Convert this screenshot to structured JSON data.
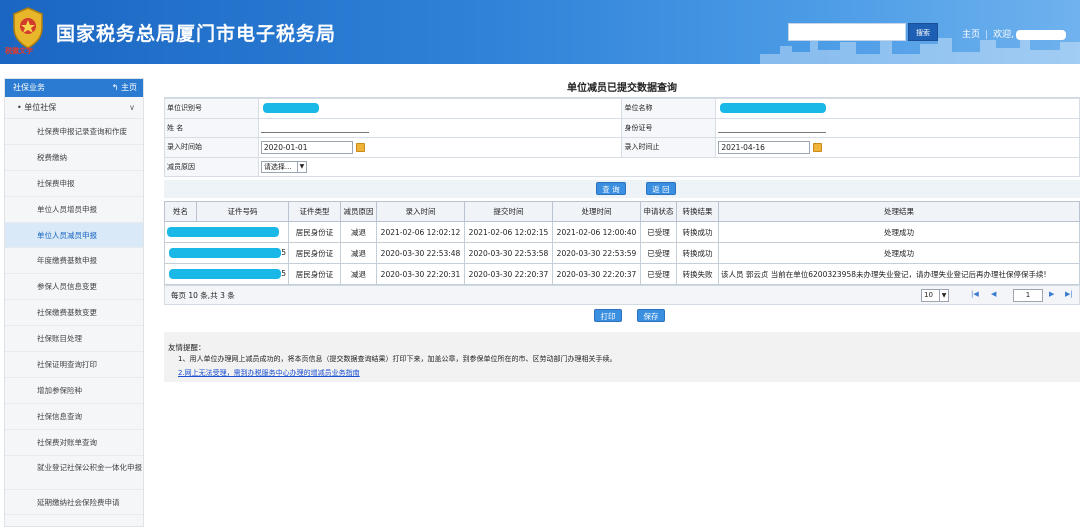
{
  "header": {
    "site_title": "国家税务总局厦门市电子税务局",
    "emblem_caption": "税徽文字",
    "search_button": "搜索",
    "home_link": "主页",
    "welcome": "欢迎,"
  },
  "sidebar": {
    "section": "社保业务",
    "home": "主页",
    "group": "单位社保",
    "items": [
      "社保费申报记录查询和作废",
      "税费缴纳",
      "社保费申报",
      "单位人员增员申报",
      "单位人员减员申报",
      "年度缴费基数申报",
      "参保人员信息变更",
      "社保缴费基数变更",
      "社保账目处理",
      "社保证明查询打印",
      "增加参保险种",
      "社保信息查询",
      "社保费对账单查询",
      "就业登记社保公积金一体化申报",
      "延期缴纳社会保险费申请"
    ]
  },
  "main": {
    "title": "单位减员已提交数据查询",
    "form": {
      "unit_id_label": "单位识别号",
      "unit_name_label": "单位名称",
      "name_label": "姓 名",
      "id_label": "身份证号",
      "date_start_label": "录入时间始",
      "date_start_value": "2020-01-01",
      "date_end_label": "录入时间止",
      "date_end_value": "2021-04-16",
      "reason_label": "减员原因",
      "reason_value": "请选择..."
    },
    "query_button": "查 询",
    "back_button": "返 回",
    "grid": {
      "headers": [
        "姓名",
        "证件号码",
        "证件类型",
        "减员原因",
        "录入时间",
        "提交时间",
        "处理时间",
        "申请状态",
        "转换结果",
        "处理结果"
      ],
      "rows": [
        {
          "idsuffix": "",
          "idtype": "居民身份证",
          "reason": "减退",
          "entry": "2021-02-06 12:02:12",
          "submit": "2021-02-06 12:02:15",
          "process": "2021-02-06 12:00:40",
          "status": "已受理",
          "convert": "转换成功",
          "result": "处理成功"
        },
        {
          "idsuffix": "5",
          "idtype": "居民身份证",
          "reason": "减退",
          "entry": "2020-03-30 22:53:48",
          "submit": "2020-03-30 22:53:58",
          "process": "2020-03-30 22:53:59",
          "status": "已受理",
          "convert": "转换成功",
          "result": "处理成功"
        },
        {
          "idsuffix": "5",
          "idtype": "居民身份证",
          "reason": "减退",
          "entry": "2020-03-30 22:20:31",
          "submit": "2020-03-30 22:20:37",
          "process": "2020-03-30 22:20:37",
          "status": "已受理",
          "convert": "转换失败",
          "result": "该人员 郭云贞 当前在单位6200323958未办理失业登记，请办理失业登记后再办理社保停保手续!"
        }
      ]
    },
    "pager": {
      "info": "每页 10 条,共 3 条",
      "page_size": "10",
      "first": "|◀",
      "prev": "◀",
      "page": "1",
      "next": "▶",
      "last": "▶|"
    },
    "print_button": "打印",
    "save_button": "保存"
  },
  "notice": {
    "title": "友情提醒：",
    "line1": "1、用人单位办理网上减员成功的，将本页信息（提交数据查询结果）打印下来，加盖公章，到参保单位所在的市、区劳动部门办理相关手续。",
    "line2": "2.网上无法受理，需到办税服务中心办理的增减员业务指南"
  },
  "colors": {
    "header_blue": "#1a66c2",
    "mask_cyan": "#19b8e6",
    "button_blue": "#3a8fe0",
    "link_blue": "#1a4fd0"
  }
}
